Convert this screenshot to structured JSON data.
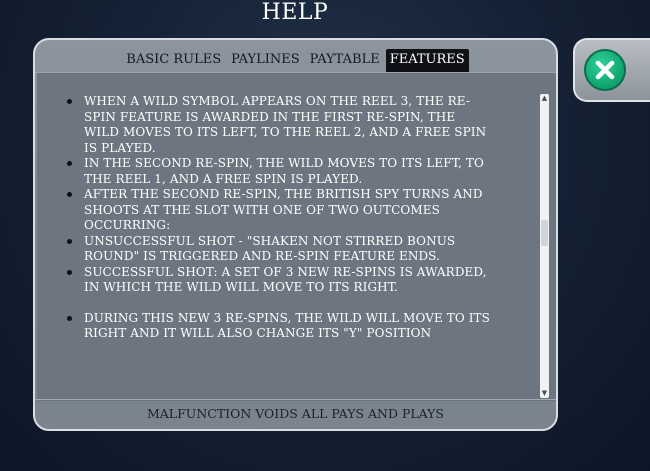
{
  "header": {
    "title": "HELP"
  },
  "tabs": [
    {
      "label": "BASIC RULES",
      "active": false
    },
    {
      "label": "PAYLINES",
      "active": false
    },
    {
      "label": "PAYTABLE",
      "active": false
    },
    {
      "label": "FEATURES",
      "active": true
    }
  ],
  "features": [
    "When a wild symbol appears on the reel 3, the re-spin feature is awarded in the first re-spin, the wild moves to its left, to the reel 2, and a free spin is played.",
    "In the second re-spin, the wild moves to its left, to the reel 1, and a free spin is played.",
    "After the second re-spin, the british spy turns and shoots at the slot with one of two outcomes occurring:",
    "Unsuccessful shot - \"Shaken not stirred bonus round\" is triggered and re-spin feature ends.",
    "Successful shot: a set of 3 new re-spins is awarded, in which the wild will move to its right.",
    "During this new 3 re-spins, the wild will move to its right and it will also change its \"Y\" position"
  ],
  "footer": {
    "text": "MALFUNCTION VOIDS ALL PAYS AND PLAYS"
  },
  "icons": {
    "close": "close-icon",
    "scroll_up": "scroll-up-arrow-icon",
    "scroll_down": "scroll-down-arrow-icon"
  },
  "colors": {
    "close_button": "#13a973",
    "active_tab": "#0f1116",
    "panel": "#7f8893"
  },
  "scroll": {
    "position_fraction": 0.45
  }
}
